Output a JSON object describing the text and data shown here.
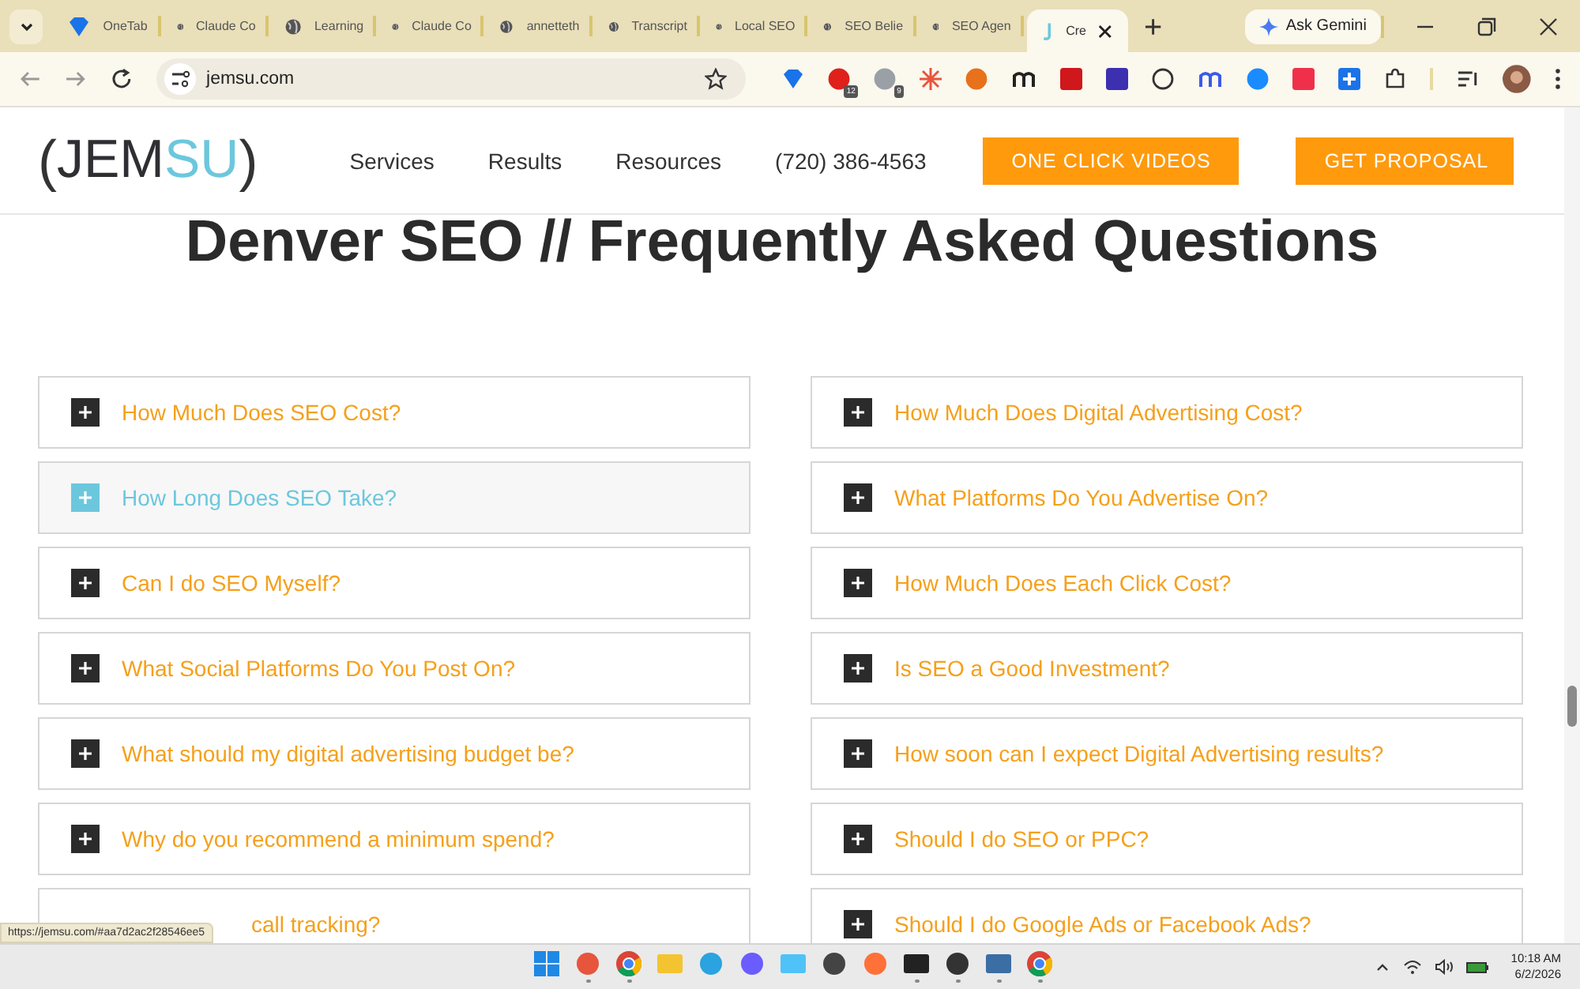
{
  "browser": {
    "tabs": [
      {
        "title": "OneTab",
        "kind": "onetab",
        "selected": false
      },
      {
        "title": "Claude Co",
        "kind": "globe",
        "selected": false
      },
      {
        "title": "Learning",
        "kind": "globe",
        "selected": false
      },
      {
        "title": "Claude Co",
        "kind": "globe",
        "selected": false
      },
      {
        "title": "annetteth",
        "kind": "globe",
        "selected": false
      },
      {
        "title": "Transcript",
        "kind": "globe",
        "selected": false
      },
      {
        "title": "Local SEO",
        "kind": "globe",
        "selected": false
      },
      {
        "title": "SEO Belie",
        "kind": "globe",
        "selected": false
      },
      {
        "title": "SEO Agen",
        "kind": "globe",
        "selected": false
      },
      {
        "title": "Cre",
        "kind": "jemsu",
        "selected": true
      }
    ],
    "gemini_button": "Ask Gemini",
    "url": "jemsu.com",
    "extensions": [
      {
        "kind": "diamond"
      },
      {
        "kind": "circle-badge",
        "badge": "12"
      },
      {
        "kind": "house-badge",
        "badge": "9"
      },
      {
        "kind": "star"
      },
      {
        "kind": "arrow"
      },
      {
        "kind": "m"
      },
      {
        "kind": "red-square"
      },
      {
        "kind": "purple-square"
      },
      {
        "kind": "chat"
      },
      {
        "kind": "rq"
      },
      {
        "kind": "blue-circle"
      },
      {
        "kind": "pink-square"
      },
      {
        "kind": "plus-square"
      },
      {
        "kind": "puzzle"
      }
    ],
    "status_url": "https://jemsu.com/#aa7d2ac2f28546ee5"
  },
  "site": {
    "logo_open": "(",
    "logo_left": "JEM",
    "logo_right": "SU",
    "logo_close": ")",
    "nav": [
      "Services",
      "Results",
      "Resources",
      "(720) 386-4563"
    ],
    "buttons": [
      "ONE CLICK VIDEOS",
      "GET PROPOSAL"
    ],
    "heading": "Denver SEO // Frequently Asked Questions",
    "faq_columns": [
      [
        {
          "question": "How Much Does SEO Cost?",
          "hovered": false
        },
        {
          "question": "How Long Does SEO Take?",
          "hovered": true
        },
        {
          "question": "Can I do SEO Myself?",
          "hovered": false
        },
        {
          "question": "What Social Platforms Do You Post On?",
          "hovered": false
        },
        {
          "question": "What should my digital advertising budget be?",
          "hovered": false
        },
        {
          "question": "Why do you recommend a minimum spend?",
          "hovered": false
        },
        {
          "question": "call tracking?",
          "hovered": false,
          "covered": true
        }
      ],
      [
        {
          "question": "How Much Does Digital Advertising Cost?",
          "hovered": false
        },
        {
          "question": "What Platforms Do You Advertise On?",
          "hovered": false
        },
        {
          "question": "How Much Does Each Click Cost?",
          "hovered": false
        },
        {
          "question": "Is SEO a Good Investment?",
          "hovered": false
        },
        {
          "question": "How soon can I expect Digital Advertising results?",
          "hovered": false
        },
        {
          "question": "Should I do SEO or PPC?",
          "hovered": false
        },
        {
          "question": "Should I do Google Ads or Facebook Ads?",
          "hovered": false
        }
      ]
    ]
  },
  "taskbar": {
    "apps": [
      {
        "kind": "start",
        "running": false
      },
      {
        "kind": "star",
        "running": true
      },
      {
        "kind": "chrome",
        "running": true
      },
      {
        "kind": "folder",
        "running": false
      },
      {
        "kind": "telegram",
        "running": false
      },
      {
        "kind": "chat",
        "running": false
      },
      {
        "kind": "notepad",
        "running": false
      },
      {
        "kind": "bug",
        "running": false
      },
      {
        "kind": "firefox",
        "running": false
      },
      {
        "kind": "terminal",
        "running": true
      },
      {
        "kind": "player",
        "running": true
      },
      {
        "kind": "python",
        "running": true
      },
      {
        "kind": "chrome",
        "running": true
      }
    ],
    "time": "10:18 AM",
    "date": "6/2/2026"
  }
}
